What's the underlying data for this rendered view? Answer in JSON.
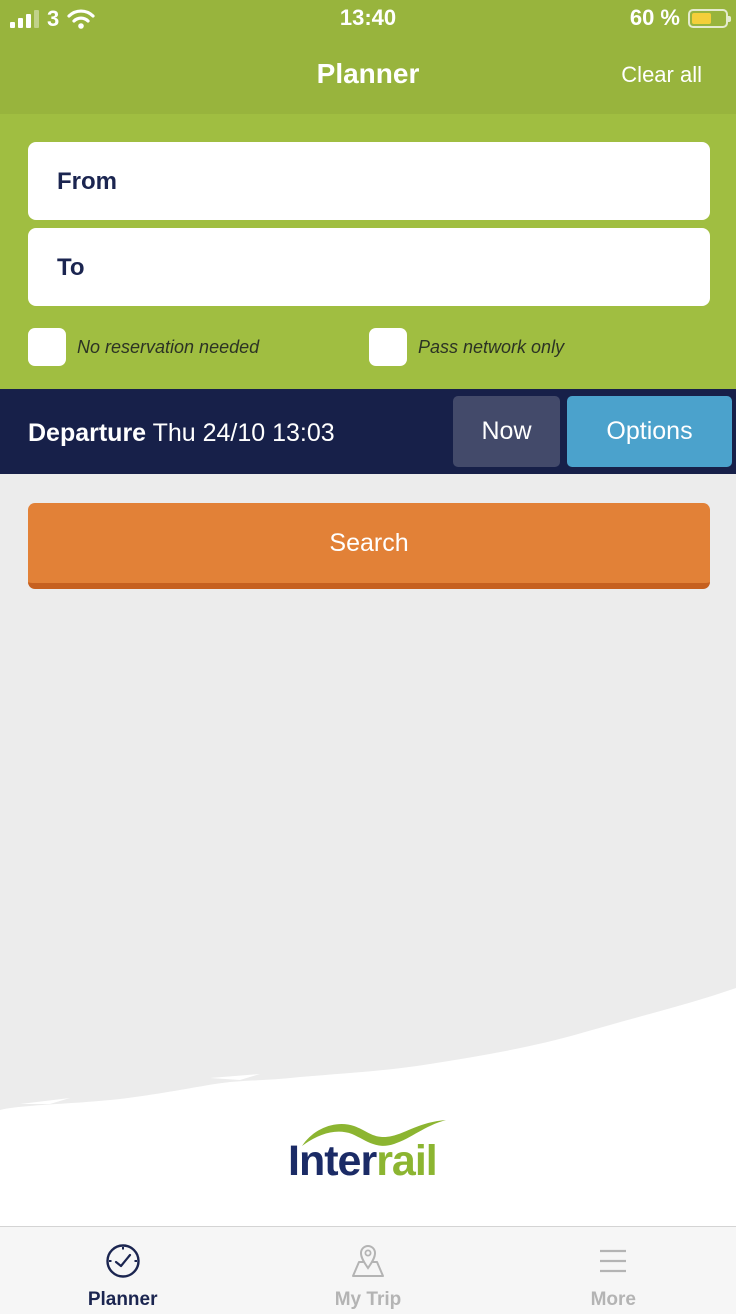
{
  "status_bar": {
    "carrier": "3",
    "time": "13:40",
    "battery": "60 %",
    "battery_level": 0.6
  },
  "nav": {
    "title": "Planner",
    "clear_all": "Clear all"
  },
  "form": {
    "from_label": "From",
    "to_label": "To",
    "no_reservation_label": "No reservation needed",
    "pass_network_label": "Pass network only"
  },
  "departure": {
    "label": "Departure",
    "value": "Thu 24/10 13:03",
    "now_label": "Now",
    "options_label": "Options"
  },
  "search": {
    "label": "Search"
  },
  "logo": {
    "text_part1": "Inter",
    "text_part2": "rail"
  },
  "tabs": [
    {
      "label": "Planner",
      "icon": "clock-icon",
      "active": true
    },
    {
      "label": "My Trip",
      "icon": "map-pin-icon",
      "active": false
    },
    {
      "label": "More",
      "icon": "menu-icon",
      "active": false
    }
  ],
  "colors": {
    "header_green": "#98b43d",
    "form_green": "#a0be41",
    "navy": "#172049",
    "now_grey": "#434a6a",
    "options_blue": "#4ba2cc",
    "search_orange": "#e28137"
  }
}
